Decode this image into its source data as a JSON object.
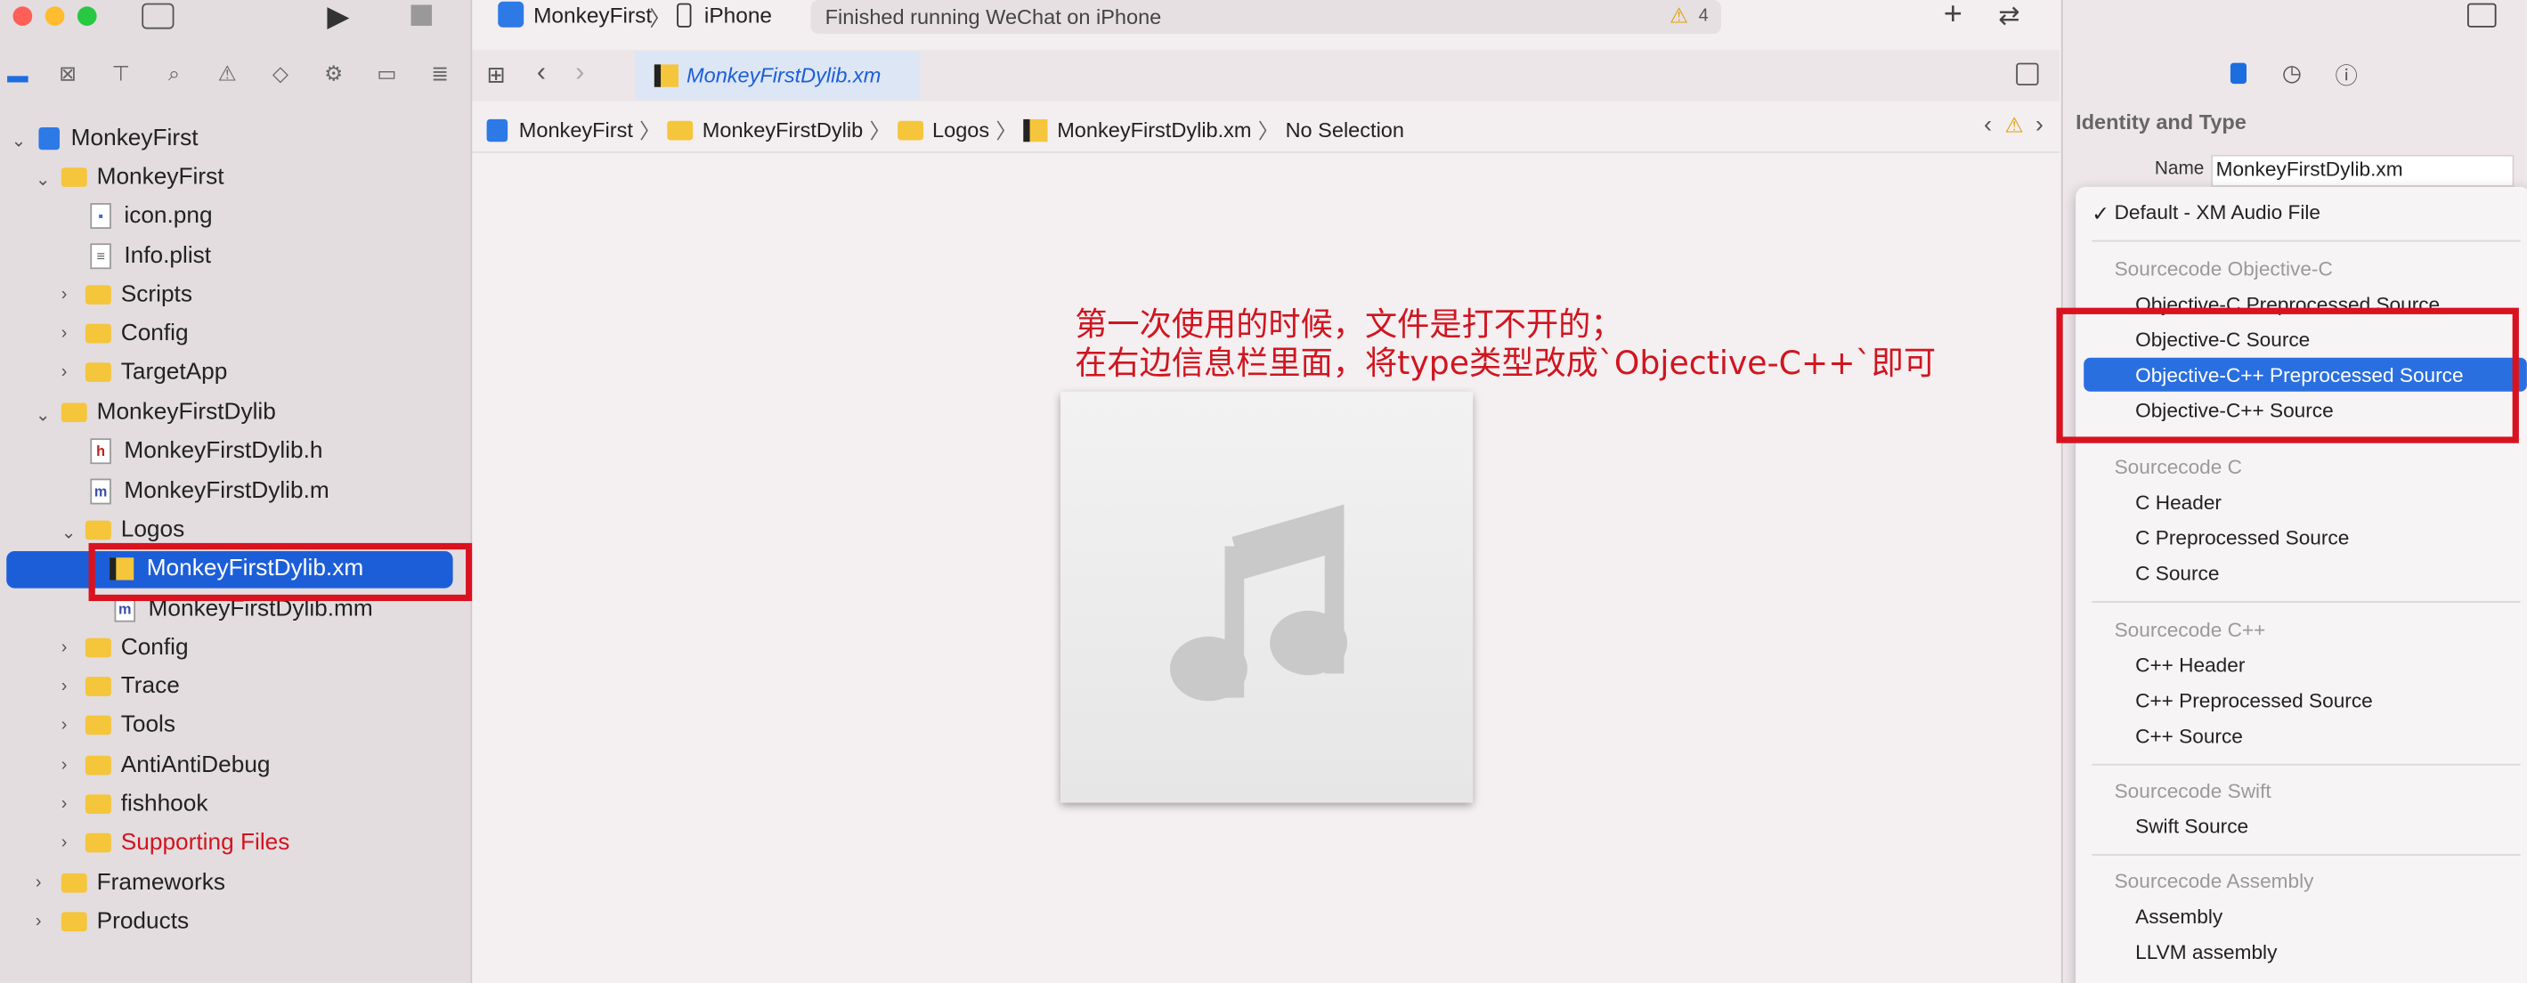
{
  "toolbar": {
    "scheme": "MonkeyFirst",
    "device": "iPhone",
    "status": "Finished running WeChat on iPhone",
    "warning_count": "4"
  },
  "tabs": [
    {
      "label": "MonkeyFirstDylib.xm"
    }
  ],
  "breadcrumb": [
    "MonkeyFirst",
    "MonkeyFirstDylib",
    "Logos",
    "MonkeyFirstDylib.xm",
    "No Selection"
  ],
  "tree": {
    "project": "MonkeyFirst",
    "group1": "MonkeyFirst",
    "icon_png": "icon.png",
    "info_plist": "Info.plist",
    "scripts": "Scripts",
    "config1": "Config",
    "targetapp": "TargetApp",
    "group2": "MonkeyFirstDylib",
    "dylib_h": "MonkeyFirstDylib.h",
    "dylib_m": "MonkeyFirstDylib.m",
    "logos": "Logos",
    "dylib_xm": "MonkeyFirstDylib.xm",
    "dylib_mm": "MonkeyFirstDylib.mm",
    "config2": "Config",
    "trace": "Trace",
    "tools": "Tools",
    "antidebug": "AntiAntiDebug",
    "fishhook": "fishhook",
    "supporting": "Supporting Files",
    "frameworks": "Frameworks",
    "products": "Products"
  },
  "annotation": {
    "line1": "第一次使用的时候，文件是打不开的；",
    "line2": "在右边信息栏里面，将type类型改成`Objective-C++`即可"
  },
  "inspector": {
    "section": "Identity and Type",
    "name_label": "Name",
    "name_value": "MonkeyFirstDylib.xm"
  },
  "menu": {
    "default": "Default - XM Audio File",
    "h_objc": "Sourcecode Objective-C",
    "objc_pre": "Objective-C Preprocessed Source",
    "objc_src": "Objective-C Source",
    "objcpp_pre": "Objective-C++ Preprocessed Source",
    "objcpp_src": "Objective-C++ Source",
    "h_c": "Sourcecode C",
    "c_header": "C Header",
    "c_pre": "C Preprocessed Source",
    "c_src": "C Source",
    "h_cpp": "Sourcecode C++",
    "cpp_header": "C++ Header",
    "cpp_pre": "C++ Preprocessed Source",
    "cpp_src": "C++ Source",
    "h_swift": "Sourcecode Swift",
    "swift_src": "Swift Source",
    "h_asm": "Sourcecode Assembly",
    "assembly": "Assembly",
    "llvm": "LLVM assembly"
  },
  "colors": {
    "selection": "#1c5ed8",
    "annotation": "#d9121f",
    "folder": "#f5c53b"
  }
}
